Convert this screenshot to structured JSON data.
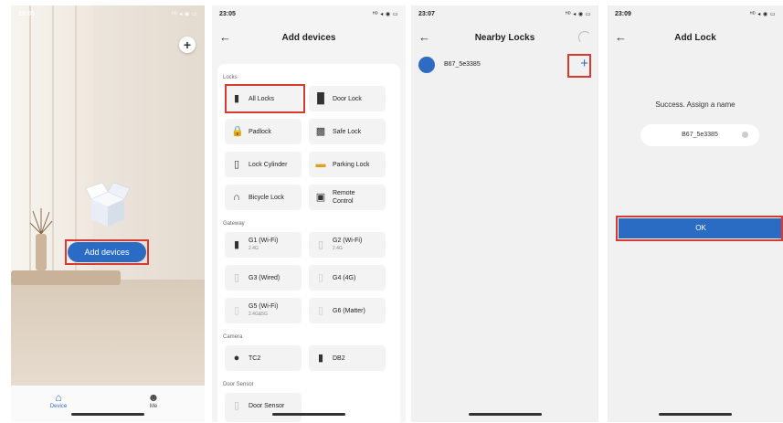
{
  "screen1": {
    "time": "23:05",
    "signal": "ᴴᴰ ◂ ◉ ▭",
    "add_icon": "plus-icon",
    "add_devices_label": "Add devices",
    "tabs": [
      {
        "label": "Device",
        "icon": "home-icon"
      },
      {
        "label": "Me",
        "icon": "person-icon"
      }
    ]
  },
  "screen2": {
    "time": "23:05",
    "signal": "ᴴᴰ ◂ ◉ ▭",
    "title": "Add devices",
    "sections": {
      "locks": "Locks",
      "gateway": "Gateway",
      "camera": "Camera",
      "door_sensor": "Door Sensor"
    },
    "locks": [
      {
        "label": "All Locks",
        "icon": "lock-all-icon"
      },
      {
        "label": "Door Lock",
        "icon": "door-lock-icon"
      },
      {
        "label": "Padlock",
        "icon": "padlock-icon"
      },
      {
        "label": "Safe Lock",
        "icon": "safe-lock-icon"
      },
      {
        "label": "Lock Cylinder",
        "icon": "cylinder-icon"
      },
      {
        "label": "Parking Lock",
        "icon": "parking-lock-icon"
      },
      {
        "label": "Bicycle Lock",
        "icon": "bicycle-lock-icon"
      },
      {
        "label": "Remote Control",
        "icon": "remote-icon"
      }
    ],
    "gateways": [
      {
        "label": "G1 (Wi-Fi)",
        "sub": "2.4G",
        "icon": "g1-icon"
      },
      {
        "label": "G2 (Wi-Fi)",
        "sub": "2.4G",
        "icon": "g2-icon"
      },
      {
        "label": "G3 (Wired)",
        "sub": "",
        "icon": "g3-icon"
      },
      {
        "label": "G4 (4G)",
        "sub": "",
        "icon": "g4-icon"
      },
      {
        "label": "G5 (Wi-Fi)",
        "sub": "2.4G&5G",
        "icon": "g5-icon"
      },
      {
        "label": "G6 (Matter)",
        "sub": "",
        "icon": "g6-icon"
      }
    ],
    "cameras": [
      {
        "label": "TC2",
        "icon": "camera-icon"
      },
      {
        "label": "DB2",
        "icon": "doorbell-icon"
      }
    ],
    "door_sensors": [
      {
        "label": "Door Sensor",
        "icon": "door-sensor-icon"
      }
    ]
  },
  "screen3": {
    "time": "23:07",
    "signal": "ᴴᴰ ◂ ◉ ▭",
    "title": "Nearby Locks",
    "lock_name": "B67_5e3385",
    "add_symbol": "+"
  },
  "screen4": {
    "time": "23:09",
    "signal": "ᴴᴰ ◂ ◉ ▭",
    "title": "Add Lock",
    "success_text": "Success. Assign a name",
    "name_value": "B67_5e3385",
    "ok_label": "OK"
  },
  "colors": {
    "accent": "#2a6cc4",
    "highlight": "#d93a2f"
  }
}
